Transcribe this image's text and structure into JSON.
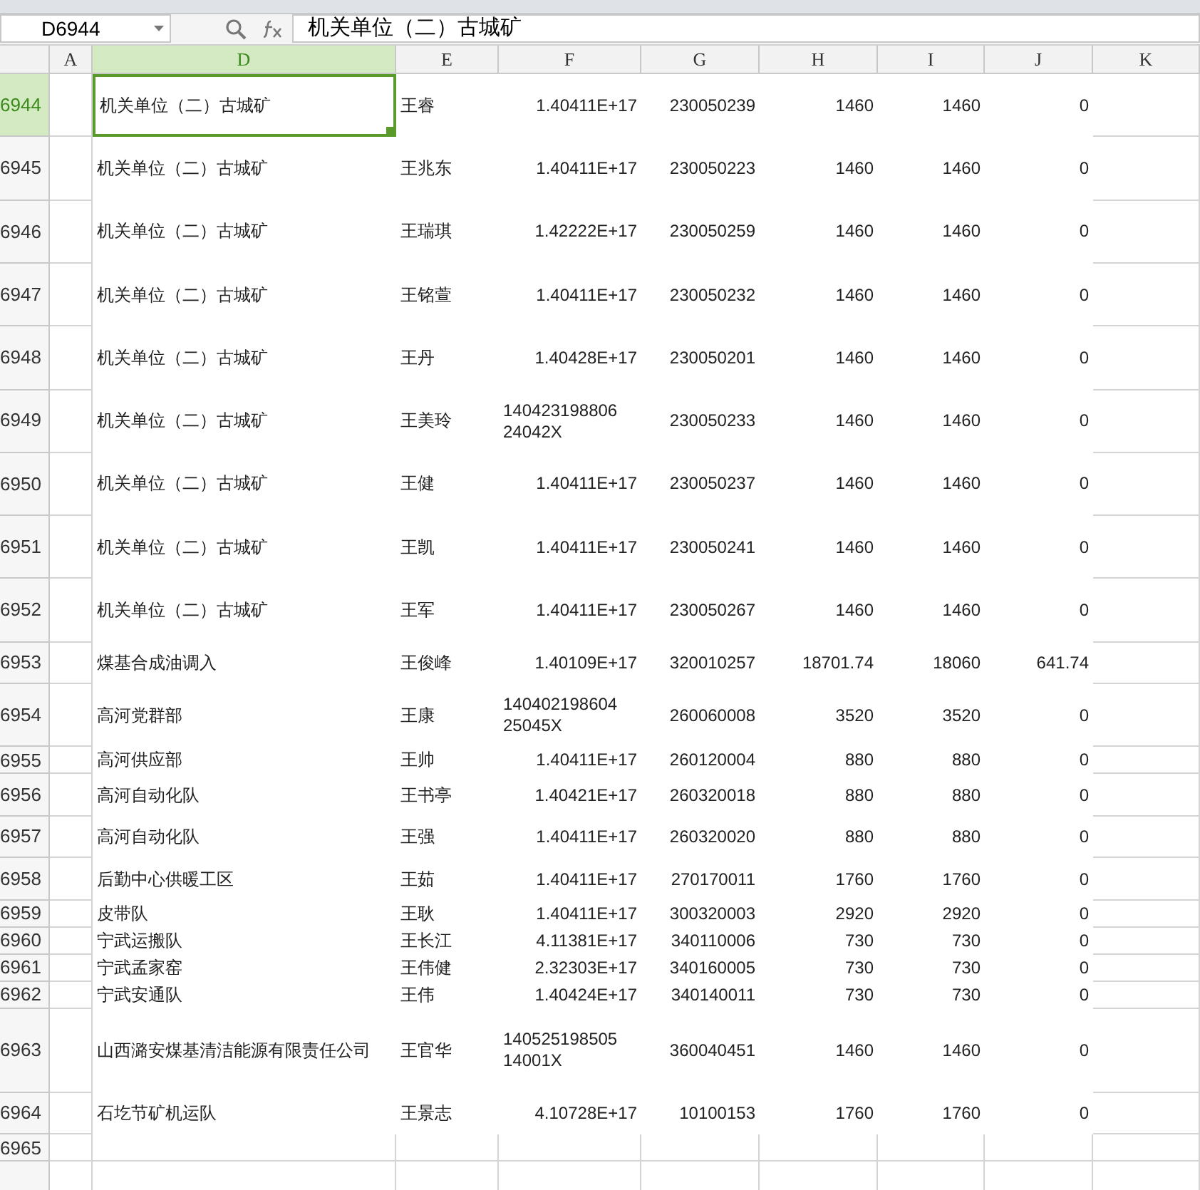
{
  "name_box": "D6944",
  "formula": "机关单位（二）古城矿",
  "columns": [
    {
      "label": "A",
      "selected": false
    },
    {
      "label": "D",
      "selected": true
    },
    {
      "label": "E",
      "selected": false
    },
    {
      "label": "F",
      "selected": false
    },
    {
      "label": "G",
      "selected": false
    },
    {
      "label": "H",
      "selected": false
    },
    {
      "label": "I",
      "selected": false
    },
    {
      "label": "J",
      "selected": false
    },
    {
      "label": "K",
      "selected": false
    }
  ],
  "rows": [
    {
      "number": "6944",
      "selected": true,
      "d": "机关单位（二）古城矿",
      "e": "王睿",
      "f": "1.40411E+17",
      "g": "230050239",
      "h": "1460",
      "i": "1460",
      "j": "0"
    },
    {
      "number": "6945",
      "selected": false,
      "d": "机关单位（二）古城矿",
      "e": "王兆东",
      "f": "1.40411E+17",
      "g": "230050223",
      "h": "1460",
      "i": "1460",
      "j": "0"
    },
    {
      "number": "6946",
      "selected": false,
      "d": "机关单位（二）古城矿",
      "e": "王瑞琪",
      "f": "1.42222E+17",
      "g": "230050259",
      "h": "1460",
      "i": "1460",
      "j": "0"
    },
    {
      "number": "6947",
      "selected": false,
      "d": "机关单位（二）古城矿",
      "e": "王铭萱",
      "f": "1.40411E+17",
      "g": "230050232",
      "h": "1460",
      "i": "1460",
      "j": "0"
    },
    {
      "number": "6948",
      "selected": false,
      "d": "机关单位（二）古城矿",
      "e": "王丹",
      "f": "1.40428E+17",
      "g": "230050201",
      "h": "1460",
      "i": "1460",
      "j": "0"
    },
    {
      "number": "6949",
      "selected": false,
      "d": "机关单位（二）古城矿",
      "e": "王美玲",
      "f": "140423198806\n24042X",
      "g": "230050233",
      "h": "1460",
      "i": "1460",
      "j": "0"
    },
    {
      "number": "6950",
      "selected": false,
      "d": "机关单位（二）古城矿",
      "e": "王健",
      "f": "1.40411E+17",
      "g": "230050237",
      "h": "1460",
      "i": "1460",
      "j": "0"
    },
    {
      "number": "6951",
      "selected": false,
      "d": "机关单位（二）古城矿",
      "e": "王凯",
      "f": "1.40411E+17",
      "g": "230050241",
      "h": "1460",
      "i": "1460",
      "j": "0"
    },
    {
      "number": "6952",
      "selected": false,
      "d": "机关单位（二）古城矿",
      "e": "王军",
      "f": "1.40411E+17",
      "g": "230050267",
      "h": "1460",
      "i": "1460",
      "j": "0"
    },
    {
      "number": "6953",
      "selected": false,
      "d": "煤基合成油调入",
      "e": "王俊峰",
      "f": "1.40109E+17",
      "g": "320010257",
      "h": "18701.74",
      "i": "18060",
      "j": "641.74"
    },
    {
      "number": "6954",
      "selected": false,
      "d": "高河党群部",
      "e": "王康",
      "f": "140402198604\n25045X",
      "g": "260060008",
      "h": "3520",
      "i": "3520",
      "j": "0"
    },
    {
      "number": "6955",
      "selected": false,
      "d": "高河供应部",
      "e": "王帅",
      "f": "1.40411E+17",
      "g": "260120004",
      "h": "880",
      "i": "880",
      "j": "0"
    },
    {
      "number": "6956",
      "selected": false,
      "d": "高河自动化队",
      "e": "王书亭",
      "f": "1.40421E+17",
      "g": "260320018",
      "h": "880",
      "i": "880",
      "j": "0"
    },
    {
      "number": "6957",
      "selected": false,
      "d": "高河自动化队",
      "e": "王强",
      "f": "1.40411E+17",
      "g": "260320020",
      "h": "880",
      "i": "880",
      "j": "0"
    },
    {
      "number": "6958",
      "selected": false,
      "d": "后勤中心供暖工区",
      "e": "王茹",
      "f": "1.40411E+17",
      "g": "270170011",
      "h": "1760",
      "i": "1760",
      "j": "0"
    },
    {
      "number": "6959",
      "selected": false,
      "d": "皮带队",
      "e": "王耿",
      "f": "1.40411E+17",
      "g": "300320003",
      "h": "2920",
      "i": "2920",
      "j": "0"
    },
    {
      "number": "6960",
      "selected": false,
      "d": "宁武运搬队",
      "e": "王长江",
      "f": "4.11381E+17",
      "g": "340110006",
      "h": "730",
      "i": "730",
      "j": "0"
    },
    {
      "number": "6961",
      "selected": false,
      "d": "宁武孟家窑",
      "e": "王伟健",
      "f": "2.32303E+17",
      "g": "340160005",
      "h": "730",
      "i": "730",
      "j": "0"
    },
    {
      "number": "6962",
      "selected": false,
      "d": "宁武安通队",
      "e": "王伟",
      "f": "1.40424E+17",
      "g": "340140011",
      "h": "730",
      "i": "730",
      "j": "0"
    },
    {
      "number": "6963",
      "selected": false,
      "d": "山西潞安煤基清洁能源有限责任公司",
      "e": "王官华",
      "f": "140525198505\n14001X",
      "g": "360040451",
      "h": "1460",
      "i": "1460",
      "j": "0"
    },
    {
      "number": "6964",
      "selected": false,
      "d": "石圪节矿机运队",
      "e": "王景志",
      "f": "4.10728E+17",
      "g": "10100153",
      "h": "1760",
      "i": "1760",
      "j": "0"
    },
    {
      "number": "6965",
      "selected": false
    }
  ]
}
